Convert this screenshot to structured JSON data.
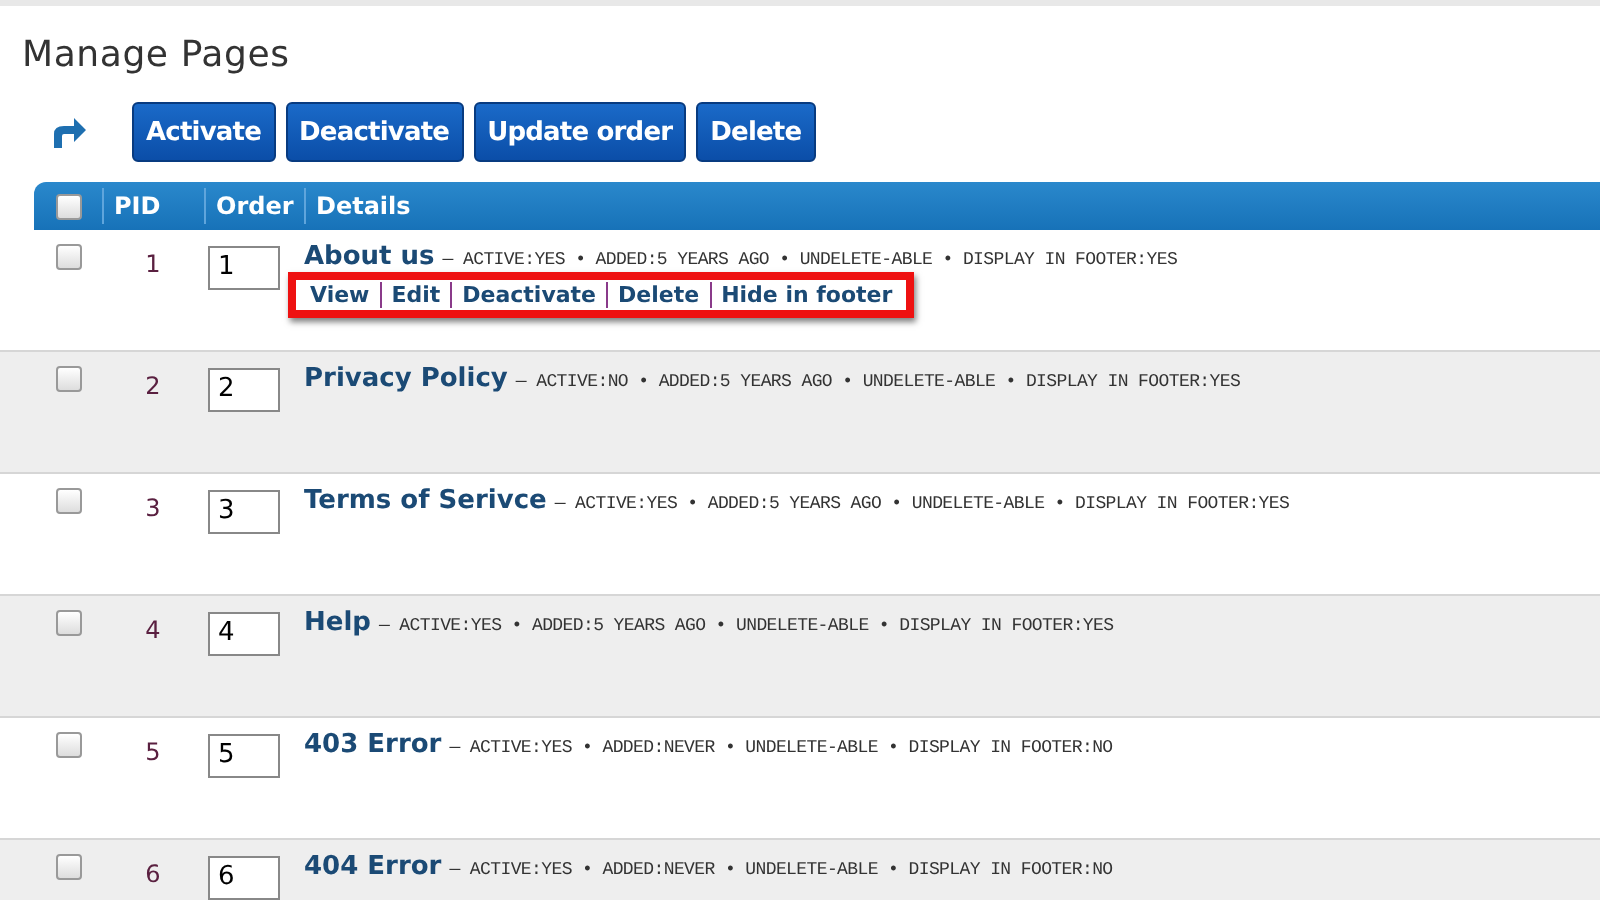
{
  "title": "Manage Pages",
  "toolbar": {
    "buttons": [
      "Activate",
      "Deactivate",
      "Update order",
      "Delete"
    ]
  },
  "table": {
    "header_checkbox": {
      "checked": false
    },
    "columns": [
      "PID",
      "Order",
      "Details"
    ],
    "rows": [
      {
        "checked": false,
        "pid": "1",
        "order": "1",
        "title": "About us",
        "meta": "— ACTIVE:YES • ADDED:5 YEARS AGO • UNDELETE-ABLE • DISPLAY IN FOOTER:YES",
        "actions": [
          "View",
          "Edit",
          "Deactivate",
          "Delete",
          "Hide in footer"
        ],
        "highlighted": true
      },
      {
        "checked": false,
        "pid": "2",
        "order": "2",
        "title": "Privacy Policy",
        "meta": "— ACTIVE:NO • ADDED:5 YEARS AGO • UNDELETE-ABLE • DISPLAY IN FOOTER:YES"
      },
      {
        "checked": false,
        "pid": "3",
        "order": "3",
        "title": "Terms of Serivce",
        "meta": "— ACTIVE:YES • ADDED:5 YEARS AGO • UNDELETE-ABLE • DISPLAY IN FOOTER:YES"
      },
      {
        "checked": false,
        "pid": "4",
        "order": "4",
        "title": "Help",
        "meta": "— ACTIVE:YES • ADDED:5 YEARS AGO • UNDELETE-ABLE • DISPLAY IN FOOTER:YES"
      },
      {
        "checked": false,
        "pid": "5",
        "order": "5",
        "title": "403 Error",
        "meta": "— ACTIVE:YES • ADDED:NEVER • UNDELETE-ABLE • DISPLAY IN FOOTER:NO"
      },
      {
        "checked": false,
        "pid": "6",
        "order": "6",
        "title": "404 Error",
        "meta": "— ACTIVE:YES • ADDED:NEVER • UNDELETE-ABLE • DISPLAY IN FOOTER:NO"
      }
    ]
  }
}
